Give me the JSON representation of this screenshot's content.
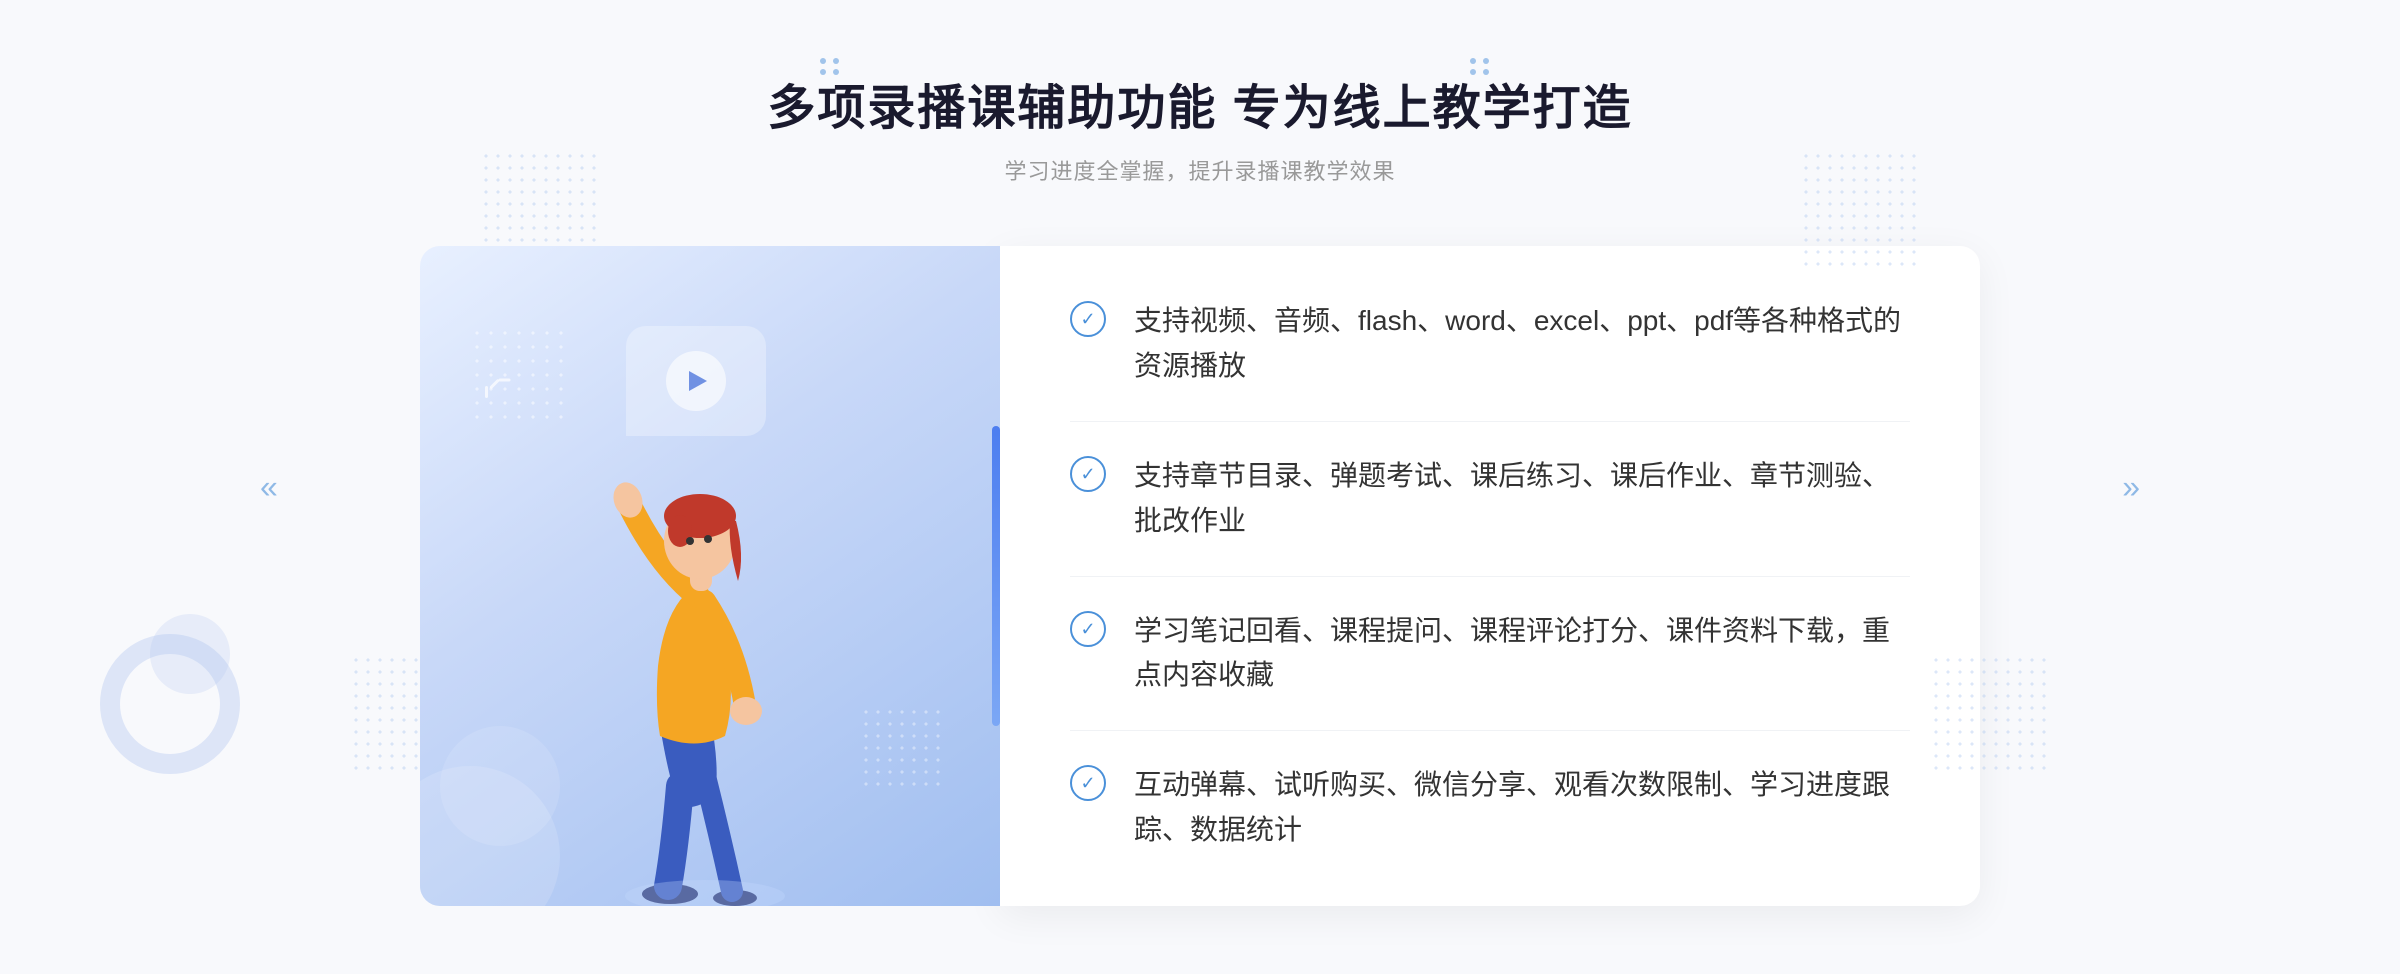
{
  "header": {
    "main_title": "多项录播课辅助功能 专为线上教学打造",
    "sub_title": "学习进度全掌握，提升录播课教学效果"
  },
  "features": [
    {
      "id": 1,
      "text": "支持视频、音频、flash、word、excel、ppt、pdf等各种格式的资源播放"
    },
    {
      "id": 2,
      "text": "支持章节目录、弹题考试、课后练习、课后作业、章节测验、批改作业"
    },
    {
      "id": 3,
      "text": "学习笔记回看、课程提问、课程评论打分、课件资料下载，重点内容收藏"
    },
    {
      "id": 4,
      "text": "互动弹幕、试听购买、微信分享、观看次数限制、学习进度跟踪、数据统计"
    }
  ],
  "icons": {
    "check": "✓",
    "play": "▶",
    "chevron_left": "«",
    "chevron_right": "»"
  },
  "colors": {
    "primary": "#4a90d9",
    "text_dark": "#1a1a2e",
    "text_gray": "#999",
    "text_body": "#333"
  }
}
